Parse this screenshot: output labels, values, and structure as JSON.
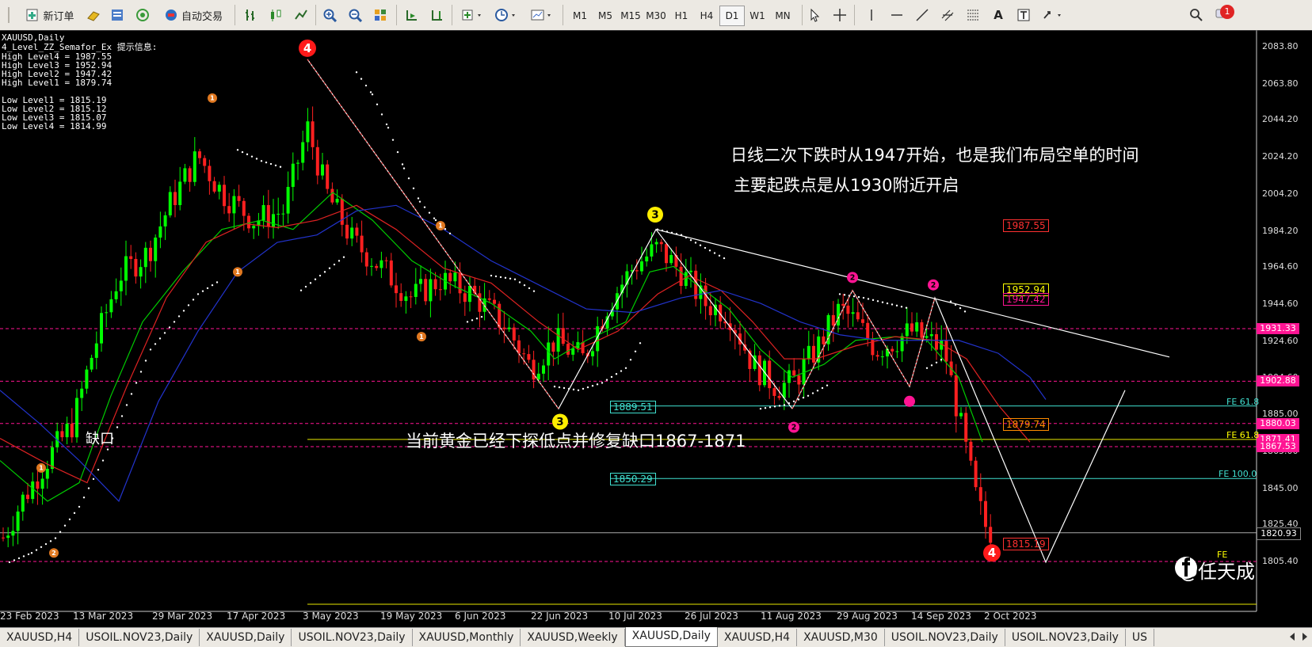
{
  "toolbar": {
    "new_order": "新订单",
    "auto_trading": "自动交易",
    "timeframes": [
      "M1",
      "M5",
      "M15",
      "M30",
      "H1",
      "H4",
      "D1",
      "W1",
      "MN"
    ],
    "active_timeframe": "D1",
    "notification_count": "1"
  },
  "chart": {
    "symbol_title": "XAUUSD,Daily",
    "indicator_name": "4_Level_ZZ_Semafor_Ex 提示信息:",
    "info_lines": [
      "High Level4 = 1987.55",
      "High Level3 = 1952.94",
      "High Level2 = 1947.42",
      "High Level1 = 1879.74",
      "",
      "Low Level1 = 1815.19",
      "Low Level2 = 1815.12",
      "Low Level3 = 1815.07",
      "Low Level4 = 1814.99"
    ],
    "price_axis": [
      "2083.80",
      "2063.80",
      "2044.20",
      "2024.20",
      "2004.20",
      "1984.20",
      "1964.60",
      "1944.60",
      "1924.60",
      "1904.60",
      "1885.00",
      "1865.00",
      "1845.00",
      "1825.40",
      "1805.40"
    ],
    "price_labels": [
      {
        "text": "1931.33",
        "bg": "#ff1493",
        "fg": "#fff"
      },
      {
        "text": "1902.88",
        "bg": "#ff1493",
        "fg": "#fff"
      },
      {
        "text": "1880.03",
        "bg": "#ff1493",
        "fg": "#fff"
      },
      {
        "text": "1871.41",
        "bg": "#ff1493",
        "fg": "#fff"
      },
      {
        "text": "1867.53",
        "bg": "#ff1493",
        "fg": "#fff"
      },
      {
        "text": "1820.93",
        "bg": "#000000",
        "fg": "#fff"
      }
    ],
    "dates": [
      "23 Feb 2023",
      "13 Mar 2023",
      "29 Mar 2023",
      "17 Apr 2023",
      "3 May 2023",
      "19 May 2023",
      "6 Jun 2023",
      "22 Jun 2023",
      "10 Jul 2023",
      "26 Jul 2023",
      "11 Aug 2023",
      "29 Aug 2023",
      "14 Sep 2023",
      "2 Oct 2023"
    ],
    "annotation_1": "日线二次下跌时从1947开始，也是我们布局空单的时间",
    "annotation_2": "主要起跌点是从1930附近开启",
    "annotation_3": "当前黄金已经下探低点并修复缺口1867-1871",
    "gap_label": "缺口",
    "level_boxes": [
      {
        "text": "1987.55",
        "color": "#ff3030"
      },
      {
        "text": "1952.94",
        "color": "#ffff00"
      },
      {
        "text": "1947.42",
        "color": "#ff1493"
      },
      {
        "text": "1879.74",
        "color": "#ff8c00"
      },
      {
        "text": "1815.19",
        "color": "#ff3030"
      },
      {
        "text": "1889.51",
        "color": "#40e0d0"
      },
      {
        "text": "1850.29",
        "color": "#40e0d0"
      }
    ],
    "fe_labels": [
      {
        "text": "FE 61.8",
        "color": "#40e0d0"
      },
      {
        "text": "FE 61.8",
        "color": "#ffff00"
      },
      {
        "text": "FE 100.0",
        "color": "#40e0d0"
      },
      {
        "text": "FE",
        "color": "#ffff00"
      }
    ],
    "semafor_marks": [
      "4",
      "3",
      "3",
      "4",
      "2",
      "2",
      "2",
      "1",
      "1",
      "1",
      "1",
      "1",
      "2"
    ],
    "watermark": "@任天成"
  },
  "tabs": [
    "XAUUSD,H4",
    "USOIL.NOV23,Daily",
    "XAUUSD,Daily",
    "USOIL.NOV23,Daily",
    "XAUUSD,Monthly",
    "XAUUSD,Weekly",
    "XAUUSD,Daily",
    "XAUUSD,H4",
    "XAUUSD,M30",
    "USOIL.NOV23,Daily",
    "USOIL.NOV23,Daily",
    "US"
  ],
  "active_tab": 6,
  "colors": {
    "bull": "#00ff00",
    "bear": "#ff2020",
    "ma_fast": "#00cc00",
    "ma_mid": "#dd2222",
    "ma_slow": "#2233cc"
  }
}
